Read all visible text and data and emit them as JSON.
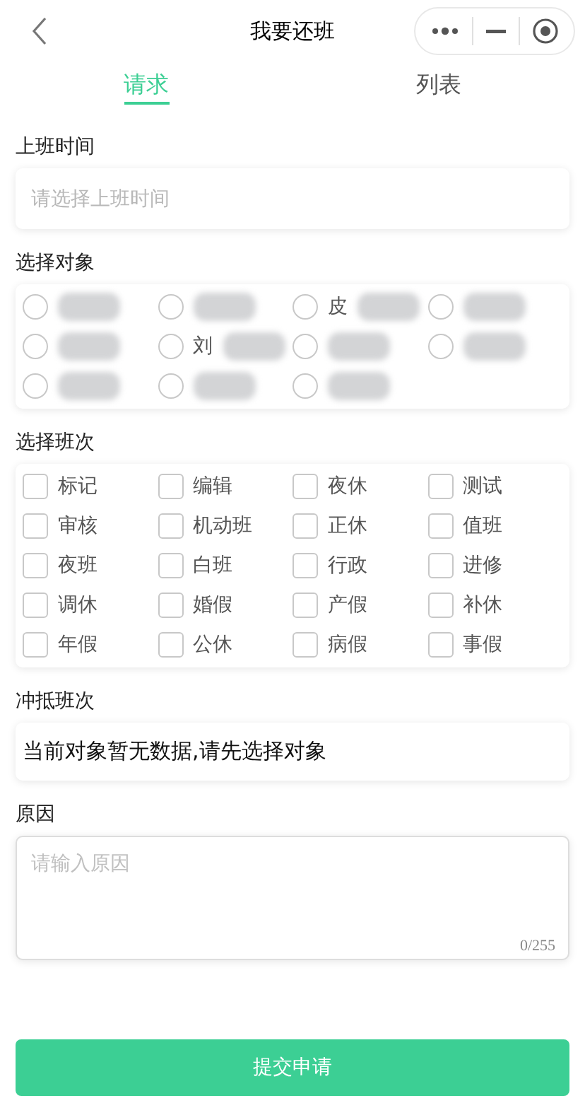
{
  "header": {
    "title": "我要还班"
  },
  "tabs": [
    {
      "label": "请求",
      "selected": true
    },
    {
      "label": "列表",
      "selected": false
    }
  ],
  "shift_time": {
    "label": "上班时间",
    "placeholder": "请选择上班时间"
  },
  "targets": {
    "label": "选择对象",
    "items": [
      {
        "selected": false
      },
      {
        "selected": false
      },
      {
        "label": "皮",
        "selected": false
      },
      {
        "selected": false
      },
      {
        "selected": false
      },
      {
        "label": "刘",
        "selected": false
      },
      {
        "selected": false
      },
      {
        "selected": false
      },
      {
        "selected": false
      },
      {
        "selected": false
      },
      {
        "selected": false
      }
    ]
  },
  "shifts": {
    "label": "选择班次",
    "items": [
      {
        "label": "标记",
        "checked": false
      },
      {
        "label": "编辑",
        "checked": false
      },
      {
        "label": "夜休",
        "checked": false
      },
      {
        "label": "测试",
        "checked": false
      },
      {
        "label": "审核",
        "checked": false
      },
      {
        "label": "机动班",
        "checked": false
      },
      {
        "label": "正休",
        "checked": false
      },
      {
        "label": "值班",
        "checked": false
      },
      {
        "label": "夜班",
        "checked": false
      },
      {
        "label": "白班",
        "checked": false
      },
      {
        "label": "行政",
        "checked": false
      },
      {
        "label": "进修",
        "checked": false
      },
      {
        "label": "调休",
        "checked": false
      },
      {
        "label": "婚假",
        "checked": false
      },
      {
        "label": "产假",
        "checked": false
      },
      {
        "label": "补休",
        "checked": false
      },
      {
        "label": "年假",
        "checked": false
      },
      {
        "label": "公休",
        "checked": false
      },
      {
        "label": "病假",
        "checked": false
      },
      {
        "label": "事假",
        "checked": false
      }
    ]
  },
  "offset": {
    "label": "冲抵班次",
    "message": "当前对象暂无数据,请先选择对象"
  },
  "reason": {
    "label": "原因",
    "placeholder": "请输入原因",
    "counter": "0/255"
  },
  "submit": {
    "label": "提交申请"
  }
}
